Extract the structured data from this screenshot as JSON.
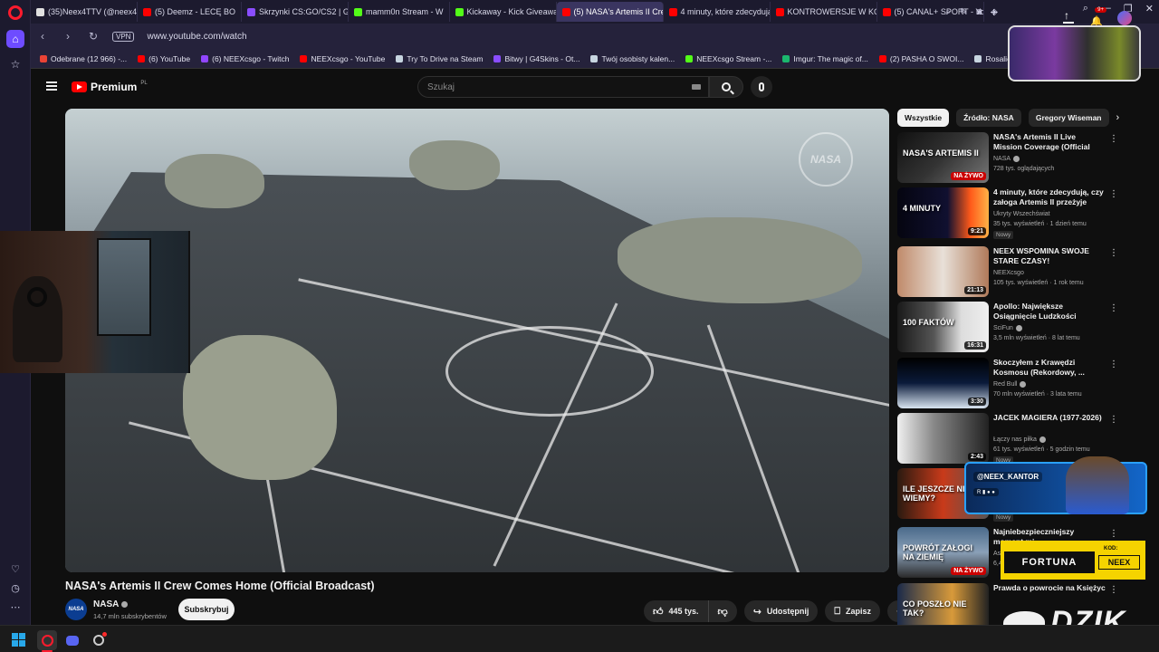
{
  "browser": {
    "tabs": [
      {
        "label": "(35)Neex4TTV (@neex4tt",
        "color": "#e0e0e0"
      },
      {
        "label": "(5) Deemz - LECĘ BO",
        "color": "#ff0000"
      },
      {
        "label": "Skrzynki CS:GO/CS2 | G4S",
        "color": "#8a4dff"
      },
      {
        "label": "mamm0n Stream - W",
        "color": "#53fc18"
      },
      {
        "label": "Kickaway - Kick Giveaway",
        "color": "#53fc18"
      },
      {
        "label": "(5) NASA's Artemis II Cre",
        "color": "#ff0000",
        "active": true
      },
      {
        "label": "4 minuty, które zdecydują",
        "color": "#ff0000"
      },
      {
        "label": "KONTROWERSJE W KOŃC",
        "color": "#ff0000"
      },
      {
        "label": "(5) CANAL+ SPORT - YouT",
        "color": "#ff0000"
      }
    ],
    "url": "www.youtube.com/watch",
    "vpn_label": "VPN",
    "bookmarks": [
      {
        "label": "Odebrane (12 966) -...",
        "color": "#ea4335"
      },
      {
        "label": "(6) YouTube",
        "color": "#ff0000"
      },
      {
        "label": "(6) NEEXcsgo - Twitch",
        "color": "#9146ff"
      },
      {
        "label": "NEEXcsgo - YouTube",
        "color": "#ff0000"
      },
      {
        "label": "Try To Drive na Steam",
        "color": "#c7d5e0"
      },
      {
        "label": "Bitwy | G4Skins - Ot...",
        "color": "#8a4dff"
      },
      {
        "label": "Twój osobisty kalen...",
        "color": "#c7d5e0"
      },
      {
        "label": "NEEXcsgo Stream -...",
        "color": "#53fc18"
      },
      {
        "label": "Imgur: The magic of...",
        "color": "#1bb76e"
      },
      {
        "label": "(2) PASHA O SWOI...",
        "color": "#ff0000"
      },
      {
        "label": "Rosalie na Steam",
        "color": "#c7d5e0"
      }
    ]
  },
  "youtube": {
    "logo_text": "Premium",
    "logo_sup": "PL",
    "search_placeholder": "Szukaj",
    "notifications": "9+"
  },
  "video": {
    "title": "NASA's Artemis II Crew Comes Home (Official Broadcast)",
    "channel": "NASA",
    "subscribers": "14,7 mln subskrybentów",
    "subscribe_label": "Subskrybuj",
    "likes": "445 tys.",
    "share_label": "Udostępnij",
    "save_label": "Zapisz",
    "more_label": "⋯",
    "watermark": "NASA"
  },
  "chips": [
    "Wszystkie",
    "Źródło: NASA",
    "Gregory Wiseman"
  ],
  "recommendations": [
    {
      "title": "NASA's Artemis II Live Mission Coverage (Official Broadcast)",
      "channel": "NASA",
      "verified": true,
      "meta": "728 tys. oglądających",
      "badge": "NA ŻYWO",
      "badge_type": "live",
      "thumb_bg": "linear-gradient(135deg,#111 0%,#333 50%,#777 100%)",
      "thumb_text": "NASA'S ARTEMIS II"
    },
    {
      "title": "4 minuty, które zdecydują, czy załoga Artemis II przeżyje",
      "channel": "Ukryty Wszechświat",
      "verified": false,
      "meta": "35 tys. wyświetleń · 1 dzień temu",
      "tag": "Nowy",
      "badge": "9:21",
      "badge_type": "dur",
      "thumb_bg": "linear-gradient(90deg,#050510 0%,#101030 55%,#ff5a1a 80%,#ffb347 100%)",
      "thumb_text": "4 MINUTY"
    },
    {
      "title": "NEEX WSPOMINA SWOJE STARE CZASY!",
      "channel": "NEEXcsgo",
      "verified": false,
      "meta": "105 tys. wyświetleń · 1 rok temu",
      "badge": "21:13",
      "badge_type": "dur",
      "thumb_bg": "linear-gradient(90deg,#c08a6a 0%,#e8e0d8 50%,#b07a5a 100%)",
      "thumb_text": ""
    },
    {
      "title": "Apollo: Największe Osiągnięcie Ludzkości",
      "channel": "SciFun",
      "verified": true,
      "meta": "3,5 mln wyświetleń · 8 lat temu",
      "badge": "16:31",
      "badge_type": "dur",
      "thumb_bg": "linear-gradient(90deg,#1a1a1a 0%,#555 40%,#ddd 70%,#eee 100%)",
      "thumb_text": "100 FAKTÓW"
    },
    {
      "title": "Skoczyłem z Krawędzi Kosmosu (Rekordowy, ...",
      "channel": "Red Bull",
      "verified": true,
      "meta": "70 mln wyświetleń · 3 lata temu",
      "badge": "3:30",
      "badge_type": "dur",
      "thumb_bg": "linear-gradient(180deg,#000 0%,#0a1a3a 50%,#d8e4f0 100%)",
      "thumb_text": ""
    },
    {
      "title": "JACEK MAGIERA (1977-2026)",
      "channel": "Łączy nas piłka",
      "verified": true,
      "meta": "61 tys. wyświetleń · 5 godzin temu",
      "tag": "Nowy",
      "badge": "2:43",
      "badge_type": "dur",
      "thumb_bg": "linear-gradient(90deg,#f0f0f0 0%,#888 40%,#222 100%)",
      "thumb_text": ""
    },
    {
      "title": "",
      "channel": "",
      "verified": false,
      "meta": "",
      "tag": "Nowy",
      "badge": "",
      "badge_type": "",
      "thumb_bg": "linear-gradient(90deg,#2a1a10 0%,#c83a1a 50%,#555 100%)",
      "thumb_text": "ILE JESZCZE NIE WIEMY?"
    },
    {
      "title": "Najniebezpieczniejszy moment mi...",
      "channel": "Astr...",
      "verified": false,
      "meta": "6,4...",
      "badge": "NA ŻYWO",
      "badge_type": "live",
      "thumb_bg": "linear-gradient(180deg,#4a6a8a 0%,#8aa0b8 50%,#2a2a2a 100%)",
      "thumb_text": "POWRÓT ZAŁOGI NA ZIEMIĘ"
    },
    {
      "title": "Prawda o powrocie na Księżyc",
      "channel": "",
      "verified": false,
      "meta": "",
      "badge": "",
      "badge_type": "",
      "thumb_bg": "linear-gradient(90deg,#1a2a4a 0%,#d89a3a 60%,#222 100%)",
      "thumb_text": "CO POSZŁO NIE TAK?"
    }
  ],
  "overlays": {
    "instagram": "@NEEX_KANTOR",
    "fortuna": "FORTUNA",
    "kod_label": "KOD:",
    "kod_value": "NEEX",
    "dzik": "DZIK"
  }
}
